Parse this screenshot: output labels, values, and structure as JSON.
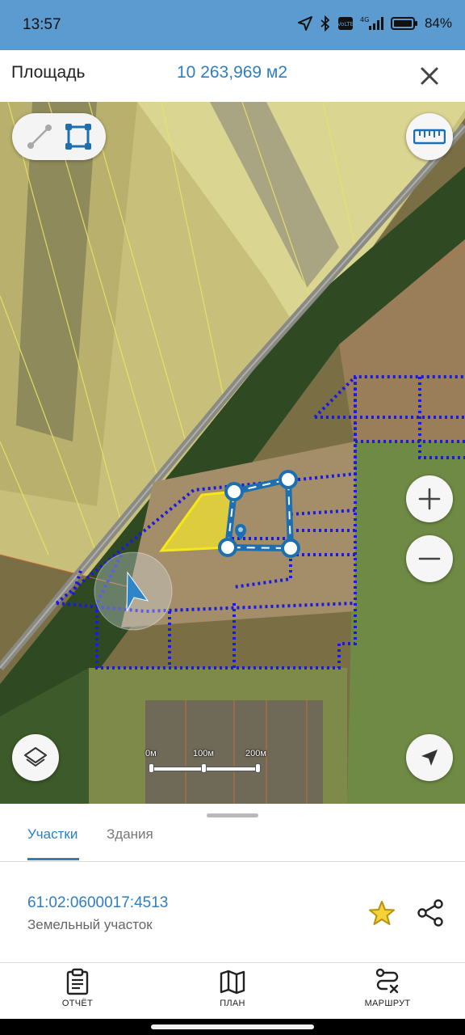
{
  "status_bar": {
    "time": "13:57",
    "battery": "84%",
    "icons": [
      "location-arrow-icon",
      "bluetooth-icon",
      "volte-icon",
      "signal-4g-icon",
      "battery-icon"
    ]
  },
  "header": {
    "title": "Площадь",
    "area_value": "10 263,969 м2",
    "close_icon": "close-icon"
  },
  "map": {
    "tools": [
      "line-measure-icon",
      "polygon-measure-icon"
    ],
    "active_tool": "polygon-measure-icon",
    "scale_labels": [
      "0м",
      "100м",
      "200м"
    ],
    "buttons": [
      "ruler-icon",
      "zoom-in-icon",
      "zoom-out-icon",
      "layers-icon",
      "locate-icon"
    ]
  },
  "sheet": {
    "tabs": [
      {
        "label": "Участки",
        "active": true
      },
      {
        "label": "Здания",
        "active": false
      }
    ],
    "plot": {
      "number": "61:02:0600017:4513",
      "type": "Земельный участок"
    }
  },
  "bottom_nav": {
    "items": [
      {
        "label": "ОТЧЁТ",
        "icon": "clipboard-icon"
      },
      {
        "label": "ПЛАН",
        "icon": "map-icon"
      },
      {
        "label": "МАРШРУТ",
        "icon": "route-icon"
      }
    ]
  },
  "colors": {
    "accent": "#2e7ec1",
    "status_bar": "#5b9bd0",
    "star": "#e0b000",
    "parcel_outline": "#1a1ae0",
    "selection_fill": "#f0e030"
  }
}
